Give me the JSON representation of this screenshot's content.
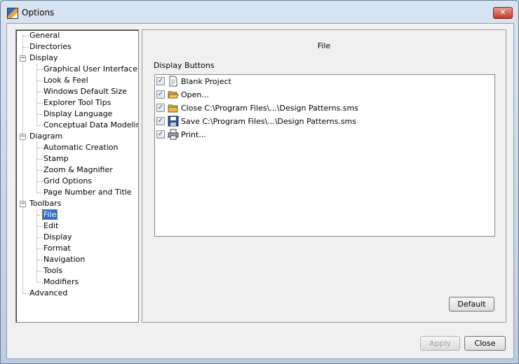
{
  "window": {
    "title": "Options"
  },
  "tree": {
    "nodes": [
      {
        "label": "General"
      },
      {
        "label": "Directories"
      },
      {
        "label": "Display"
      },
      {
        "label": "Graphical User Interface"
      },
      {
        "label": "Look & Feel"
      },
      {
        "label": "Windows Default Size"
      },
      {
        "label": "Explorer Tool Tips"
      },
      {
        "label": "Display Language"
      },
      {
        "label": "Conceptual Data Modeling"
      },
      {
        "label": "Diagram"
      },
      {
        "label": "Automatic Creation"
      },
      {
        "label": "Stamp"
      },
      {
        "label": "Zoom & Magnifier"
      },
      {
        "label": "Grid Options"
      },
      {
        "label": "Page Number and Title"
      },
      {
        "label": "Toolbars"
      },
      {
        "label": "File"
      },
      {
        "label": "Edit"
      },
      {
        "label": "Display"
      },
      {
        "label": "Format"
      },
      {
        "label": "Navigation"
      },
      {
        "label": "Tools"
      },
      {
        "label": "Modifiers"
      },
      {
        "label": "Advanced"
      }
    ],
    "expander_symbol": "−"
  },
  "panel": {
    "title": "File",
    "section_label": "Display Buttons",
    "items": [
      {
        "label": "Blank Project",
        "checked": true,
        "icon": "blank-page-icon"
      },
      {
        "label": "Open...",
        "checked": true,
        "icon": "open-folder-icon"
      },
      {
        "label": "Close C:\\Program Files\\...\\Design Patterns.sms",
        "checked": true,
        "icon": "close-folder-icon"
      },
      {
        "label": "Save C:\\Program Files\\...\\Design Patterns.sms",
        "checked": true,
        "icon": "floppy-disk-icon"
      },
      {
        "label": "Print...",
        "checked": true,
        "icon": "printer-icon"
      }
    ],
    "check_mark": "✓",
    "default_button": "Default"
  },
  "footer": {
    "apply_button": "Apply",
    "close_button": "Close"
  },
  "titlebar": {
    "close_glyph": "✕"
  }
}
